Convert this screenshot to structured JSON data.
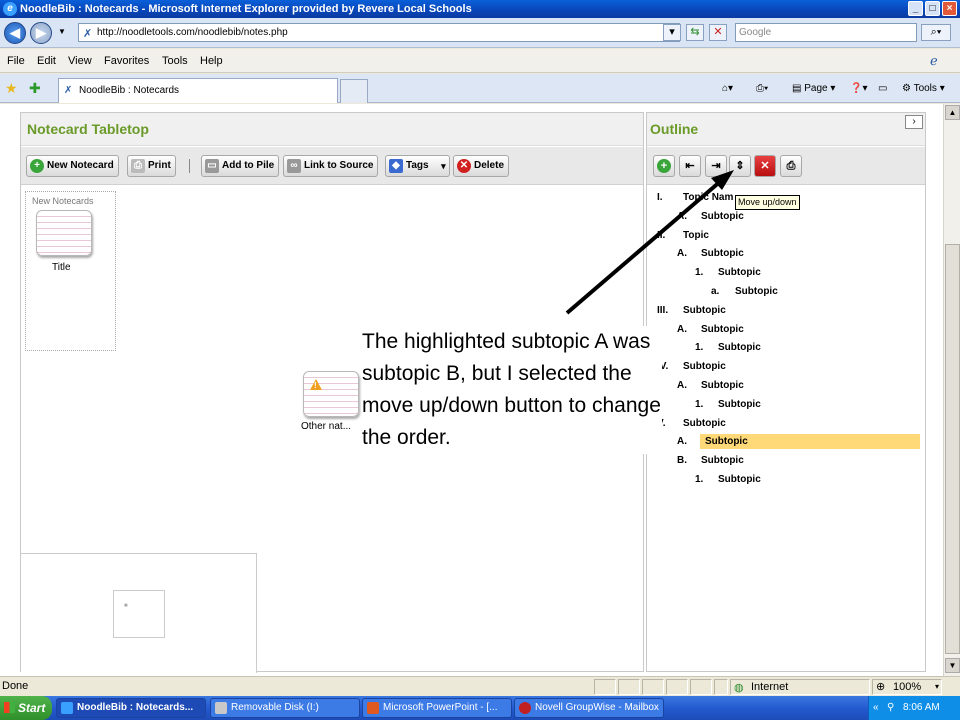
{
  "window": {
    "title": "NoodleBib : Notecards - Microsoft Internet Explorer provided by Revere Local Schools"
  },
  "address_bar": {
    "url": "http://noodletools.com/noodlebib/notes.php",
    "search_placeholder": "Google"
  },
  "menu": [
    "File",
    "Edit",
    "View",
    "Favorites",
    "Tools",
    "Help"
  ],
  "tab": {
    "label": "NoodleBib : Notecards"
  },
  "command_bar": {
    "page": "Page",
    "tools": "Tools"
  },
  "tabletop": {
    "title": "Notecard Tabletop",
    "buttons": {
      "new_notecard": "New Notecard",
      "print": "Print",
      "add_to_pile": "Add to Pile",
      "link_to_source": "Link to Source",
      "tags": "Tags",
      "delete": "Delete"
    },
    "separator": "|",
    "pile": {
      "title": "New Notecards",
      "card_title": "Title"
    },
    "other_card_label": "Other nat..."
  },
  "outline": {
    "title": "Outline",
    "collapse_icon": "›",
    "tooltip": "Move up/down",
    "items": [
      {
        "num": "I.",
        "text": "Topic Nam",
        "level": 0
      },
      {
        "num": "A.",
        "text": "Subtopic",
        "level": 1
      },
      {
        "num": "II.",
        "text": "Topic",
        "level": 0
      },
      {
        "num": "A.",
        "text": "Subtopic",
        "level": 1
      },
      {
        "num": "1.",
        "text": "Subtopic",
        "level": 2
      },
      {
        "num": "a.",
        "text": "Subtopic",
        "level": 3
      },
      {
        "num": "III.",
        "text": "Subtopic",
        "level": 0
      },
      {
        "num": "A.",
        "text": "Subtopic",
        "level": 1
      },
      {
        "num": "1.",
        "text": "Subtopic",
        "level": 2
      },
      {
        "num": "IV.",
        "text": "Subtopic",
        "level": 0
      },
      {
        "num": "A.",
        "text": "Subtopic",
        "level": 1
      },
      {
        "num": "1.",
        "text": "Subtopic",
        "level": 2
      },
      {
        "num": "V.",
        "text": "Subtopic",
        "level": 0
      },
      {
        "num": "A.",
        "text": "Subtopic",
        "level": 1,
        "highlighted": true
      },
      {
        "num": "B.",
        "text": "Subtopic",
        "level": 1
      },
      {
        "num": "1.",
        "text": "Subtopic",
        "level": 2
      }
    ]
  },
  "annotation": {
    "text": "The highlighted subtopic A was subtopic B, but I selected the move up/down button to change the order."
  },
  "status_bar": {
    "status": "Done",
    "zone": "Internet",
    "zoom": "100%"
  },
  "taskbar": {
    "start": "Start",
    "tasks": [
      {
        "label": "NoodleBib : Notecards...",
        "active": true
      },
      {
        "label": "Removable Disk (I:)",
        "active": false
      },
      {
        "label": "Microsoft PowerPoint - [...",
        "active": false
      },
      {
        "label": "Novell GroupWise - Mailbox",
        "active": false
      }
    ],
    "tray_chevron": "«",
    "clock": "8:06 AM"
  },
  "colors": {
    "panel_title_green": "#6a9a28",
    "highlight_yellow": "#ffd878",
    "titlebar_blue": "#0845b8"
  }
}
